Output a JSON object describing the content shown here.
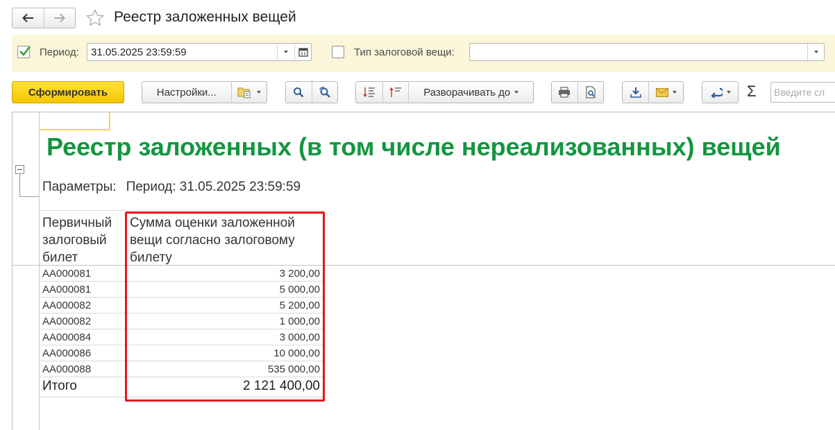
{
  "window": {
    "title": "Реестр заложенных вещей"
  },
  "filters": {
    "period": {
      "checked": true,
      "label": "Период:",
      "value": "31.05.2025 23:59:59"
    },
    "pledge_type": {
      "checked": false,
      "label": "Тип залоговой вещи:",
      "value": ""
    }
  },
  "toolbar": {
    "generate_label": "Сформировать",
    "settings_label": "Настройки...",
    "expand_label": "Разворачивать до",
    "search_placeholder": "Введите сл"
  },
  "report": {
    "title": "Реестр заложенных (в том числе нереализованных) вещей",
    "params_label": "Параметры:",
    "params_value": "Период: 31.05.2025 23:59:59",
    "columns": [
      "Первичный залоговый билет",
      "Сумма оценки заложенной вещи согласно залоговому билету"
    ],
    "rows": [
      {
        "ticket": "АА000081",
        "amount": "3 200,00"
      },
      {
        "ticket": "АА000081",
        "amount": "5 000,00"
      },
      {
        "ticket": "АА000082",
        "amount": "5 200,00"
      },
      {
        "ticket": "АА000082",
        "amount": "1 000,00"
      },
      {
        "ticket": "АА000084",
        "amount": "3 000,00"
      },
      {
        "ticket": "АА000086",
        "amount": "10 000,00"
      },
      {
        "ticket": "АА000088",
        "amount": "535 000,00"
      }
    ],
    "total_label": "Итого",
    "total_value": "2 121 400,00"
  },
  "colors": {
    "accent": "#f6c500",
    "title_green": "#12963f",
    "highlight_red": "#e8141e",
    "panel_bg": "#fbf6d9"
  }
}
